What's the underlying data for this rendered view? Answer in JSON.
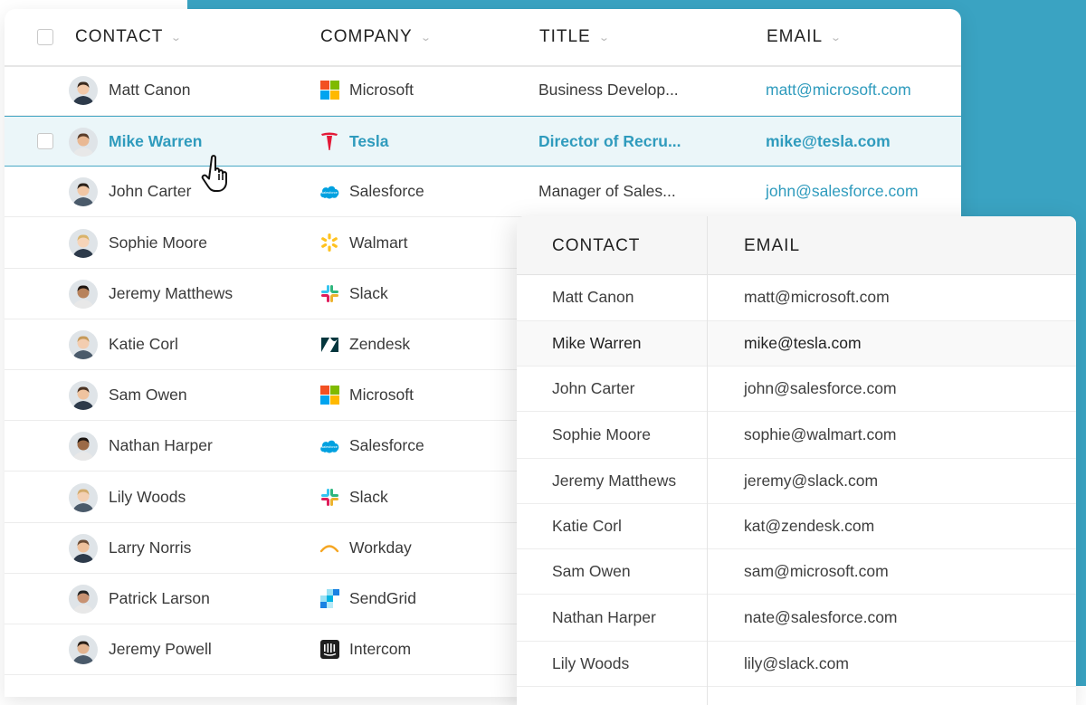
{
  "table": {
    "headers": {
      "contact": "CONTACT",
      "company": "COMPANY",
      "title": "TITLE",
      "email": "EMAIL"
    },
    "rows": [
      {
        "name": "Matt Canon",
        "company": "Microsoft",
        "logo": "microsoft",
        "title": "Business Develop...",
        "email": "matt@microsoft.com"
      },
      {
        "name": "Mike Warren",
        "company": "Tesla",
        "logo": "tesla",
        "title": "Director of Recru...",
        "email": "mike@tesla.com"
      },
      {
        "name": "John Carter",
        "company": "Salesforce",
        "logo": "salesforce",
        "title": "Manager of Sales...",
        "email": "john@salesforce.com"
      },
      {
        "name": "Sophie Moore",
        "company": "Walmart",
        "logo": "walmart",
        "title": "",
        "email": ""
      },
      {
        "name": "Jeremy Matthews",
        "company": "Slack",
        "logo": "slack",
        "title": "",
        "email": ""
      },
      {
        "name": "Katie Corl",
        "company": "Zendesk",
        "logo": "zendesk",
        "title": "",
        "email": ""
      },
      {
        "name": "Sam Owen",
        "company": "Microsoft",
        "logo": "microsoft",
        "title": "",
        "email": ""
      },
      {
        "name": "Nathan Harper",
        "company": "Salesforce",
        "logo": "salesforce",
        "title": "",
        "email": ""
      },
      {
        "name": "Lily Woods",
        "company": "Slack",
        "logo": "slack",
        "title": "",
        "email": ""
      },
      {
        "name": "Larry Norris",
        "company": "Workday",
        "logo": "workday",
        "title": "",
        "email": ""
      },
      {
        "name": "Patrick Larson",
        "company": "SendGrid",
        "logo": "sendgrid",
        "title": "",
        "email": ""
      },
      {
        "name": "Jeremy Powell",
        "company": "Intercom",
        "logo": "intercom",
        "title": "",
        "email": ""
      }
    ]
  },
  "overlay": {
    "headers": {
      "contact": "CONTACT",
      "email": "EMAIL"
    },
    "rows": [
      {
        "name": "Matt Canon",
        "email": "matt@microsoft.com"
      },
      {
        "name": "Mike Warren",
        "email": "mike@tesla.com"
      },
      {
        "name": "John Carter",
        "email": "john@salesforce.com"
      },
      {
        "name": "Sophie Moore",
        "email": "sophie@walmart.com"
      },
      {
        "name": "Jeremy Matthews",
        "email": "jeremy@slack.com"
      },
      {
        "name": "Katie Corl",
        "email": "kat@zendesk.com"
      },
      {
        "name": "Sam Owen",
        "email": "sam@microsoft.com"
      },
      {
        "name": "Nathan Harper",
        "email": "nate@salesforce.com"
      },
      {
        "name": "Lily Woods",
        "email": "lily@slack.com"
      }
    ]
  },
  "colors": {
    "accent": "#2f9bbd",
    "background": "#3aa3c2",
    "selected_row": "#ebf6f9"
  }
}
